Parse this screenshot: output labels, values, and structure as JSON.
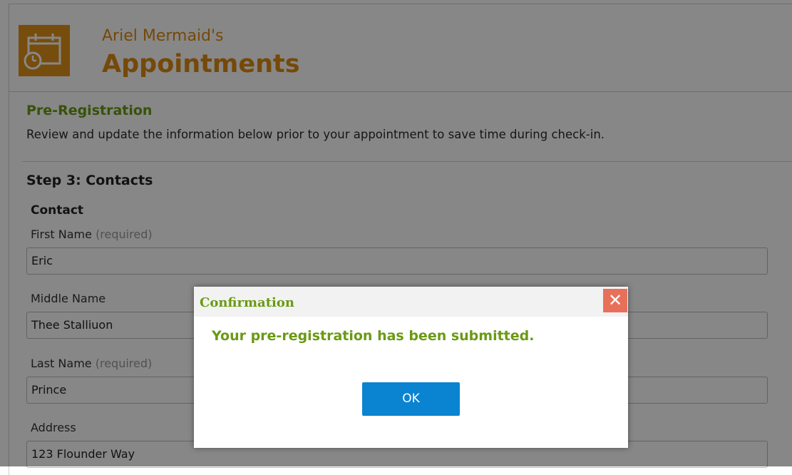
{
  "header": {
    "owner": "Ariel Mermaid's",
    "title": "Appointments",
    "logo_icon": "calendar-clock-icon",
    "accent_color": "#dd8a12"
  },
  "prereg": {
    "title": "Pre-Registration",
    "description": "Review and update the information below prior to your appointment to save time during check-in."
  },
  "step": {
    "title": "Step 3: Contacts",
    "section": "Contact"
  },
  "fields": {
    "first_name": {
      "label": "First Name",
      "qualifier": "(required)",
      "value": "Eric"
    },
    "middle_name": {
      "label": "Middle Name",
      "value": "Thee Stalliuon"
    },
    "last_name": {
      "label": "Last Name",
      "qualifier": "(required)",
      "value": "Prince"
    },
    "address": {
      "label": "Address",
      "value": "123 Flounder Way"
    }
  },
  "dialog": {
    "title": "Confirmation",
    "close_icon": "close-icon",
    "message": "Your pre-registration has been submitted.",
    "ok_label": "OK",
    "button_color": "#0a84d1",
    "close_color": "#e8705a",
    "message_color": "#6a9a14"
  }
}
